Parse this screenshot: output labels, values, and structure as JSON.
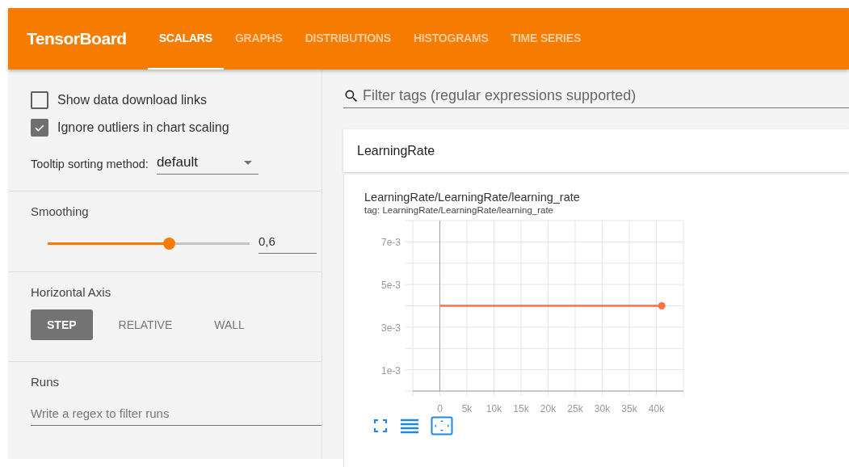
{
  "app": {
    "title": "TensorBoard"
  },
  "tabs": [
    {
      "label": "SCALARS",
      "selected": true
    },
    {
      "label": "GRAPHS",
      "selected": false
    },
    {
      "label": "DISTRIBUTIONS",
      "selected": false
    },
    {
      "label": "HISTOGRAMS",
      "selected": false
    },
    {
      "label": "TIME SERIES",
      "selected": false
    }
  ],
  "sidebar": {
    "options": [
      {
        "label": "Show data download links",
        "checked": false
      },
      {
        "label": "Ignore outliers in chart scaling",
        "checked": true
      }
    ],
    "tooltip_sorting": {
      "label": "Tooltip sorting method:",
      "value": "default"
    },
    "smoothing": {
      "label": "Smoothing",
      "level": 0.6,
      "value": "0,6"
    },
    "horizontal_axis": {
      "label": "Horizontal Axis",
      "options": [
        {
          "label": "STEP",
          "selected": true
        },
        {
          "label": "RELATIVE",
          "selected": false
        },
        {
          "label": "WALL",
          "selected": false
        }
      ]
    },
    "runs": {
      "label": "Runs",
      "placeholder": "Write a regex to filter runs"
    }
  },
  "search": {
    "placeholder": "Filter tags (regular expressions supported)"
  },
  "category": {
    "title": "LearningRate"
  },
  "chart_card": {
    "title": "LearningRate/LearningRate/learning_rate",
    "subtitle": "tag: LearningRate/LearningRate/learning_rate",
    "chart_data": {
      "type": "line",
      "x": [
        0,
        41000
      ],
      "series": [
        {
          "color": "#ff7043",
          "values": [
            0.004,
            0.004
          ]
        }
      ],
      "grid": true,
      "xlim": [
        -5000,
        45000
      ],
      "ylim": [
        0,
        0.008
      ],
      "xticks": [
        {
          "value": 0,
          "label": "0"
        },
        {
          "value": 5000,
          "label": "5k"
        },
        {
          "value": 10000,
          "label": "10k"
        },
        {
          "value": 15000,
          "label": "15k"
        },
        {
          "value": 20000,
          "label": "20k"
        },
        {
          "value": 25000,
          "label": "25k"
        },
        {
          "value": 30000,
          "label": "30k"
        },
        {
          "value": 35000,
          "label": "35k"
        },
        {
          "value": 40000,
          "label": "40k"
        }
      ],
      "yticks": [
        {
          "value": 0.001,
          "label": "1e-3"
        },
        {
          "value": 0.003,
          "label": "3e-3"
        },
        {
          "value": 0.005,
          "label": "5e-3"
        },
        {
          "value": 0.007,
          "label": "7e-3"
        }
      ]
    }
  }
}
